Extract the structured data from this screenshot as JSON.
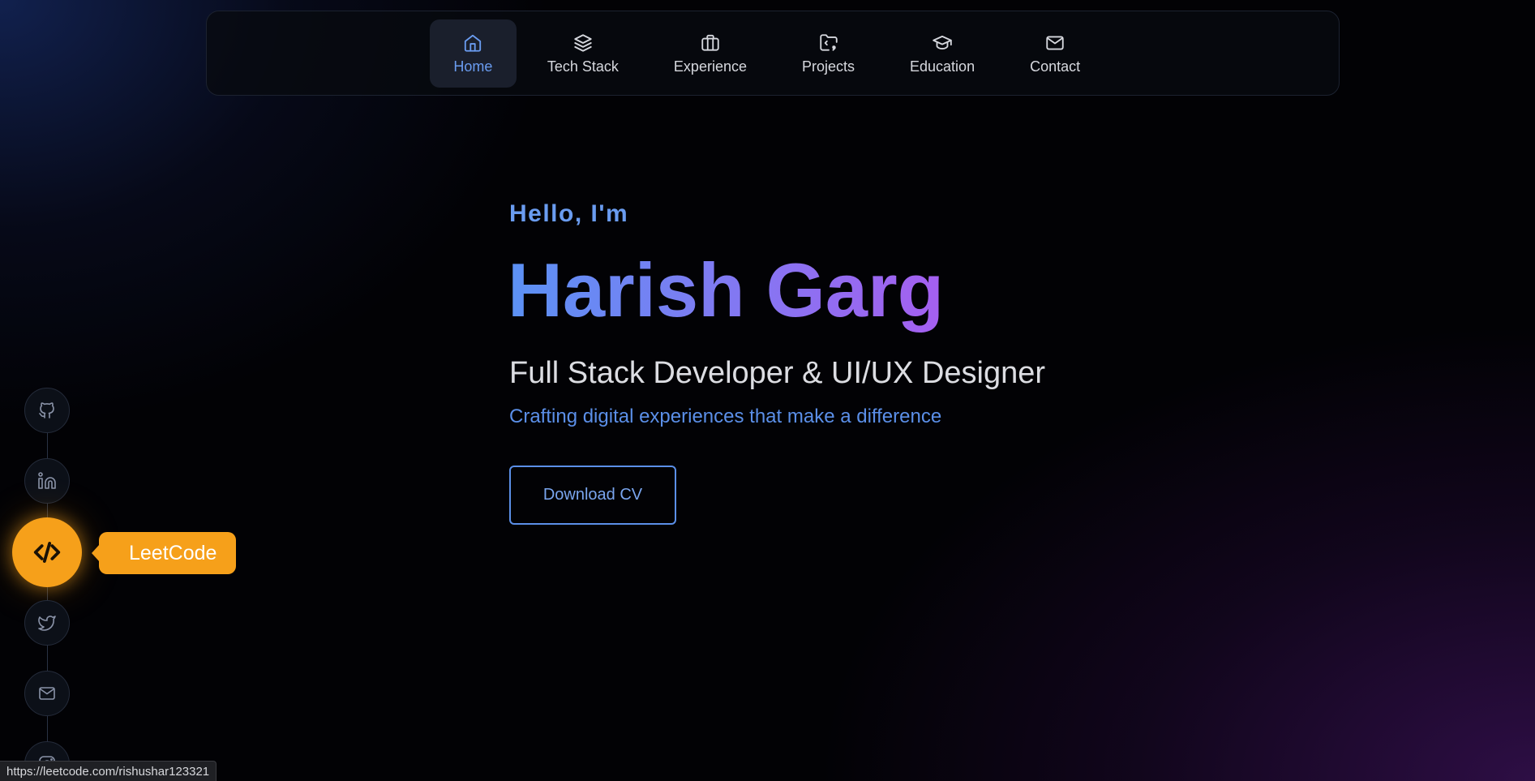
{
  "nav": {
    "items": [
      {
        "label": "Home",
        "icon": "home-icon",
        "active": true
      },
      {
        "label": "Tech Stack",
        "icon": "layers-icon",
        "active": false
      },
      {
        "label": "Experience",
        "icon": "briefcase-icon",
        "active": false
      },
      {
        "label": "Projects",
        "icon": "folder-code-icon",
        "active": false
      },
      {
        "label": "Education",
        "icon": "graduation-cap-icon",
        "active": false
      },
      {
        "label": "Contact",
        "icon": "mail-icon",
        "active": false
      }
    ]
  },
  "hero": {
    "greeting": "Hello, I'm",
    "name": "Harish Garg",
    "role": "Full Stack Developer & UI/UX Designer",
    "tagline": "Crafting digital experiences that make a difference",
    "cv_button": "Download CV"
  },
  "social": {
    "items": [
      {
        "icon": "github-icon"
      },
      {
        "icon": "linkedin-icon"
      },
      {
        "icon": "code-icon",
        "highlighted": true
      },
      {
        "icon": "twitter-icon"
      },
      {
        "icon": "mail-icon"
      },
      {
        "icon": "instagram-icon"
      }
    ],
    "tooltip": "LeetCode"
  },
  "status_bar": {
    "url": "https://leetcode.com/rishushar123321"
  },
  "colors": {
    "accent_blue": "#6a9cf0",
    "gradient_start": "#5b92f5",
    "gradient_end": "#a55ff0",
    "leetcode_orange": "#f6a01a"
  }
}
